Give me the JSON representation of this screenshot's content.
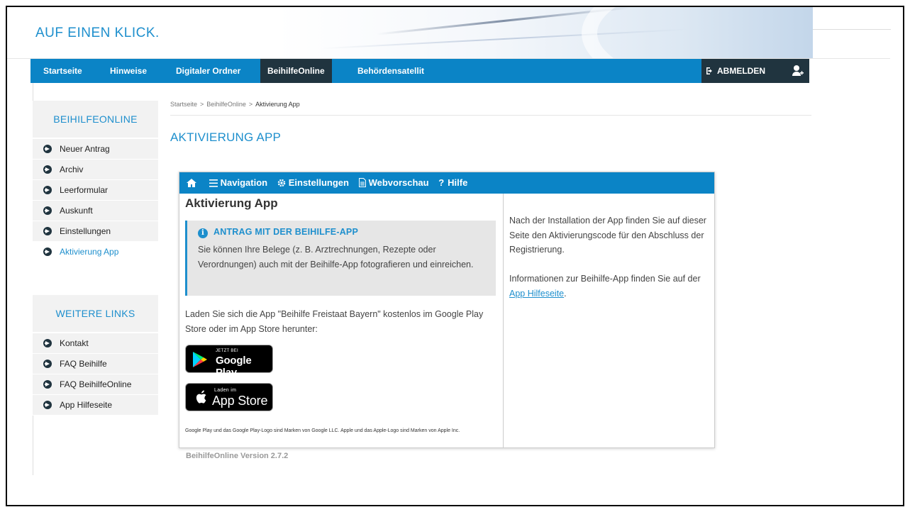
{
  "banner": {
    "tagline": "AUF EINEN KLICK."
  },
  "nav": {
    "items": [
      "Startseite",
      "Hinweise",
      "Digitaler Ordner",
      "BeihilfeOnline",
      "Behördensatellit"
    ],
    "logout": "ABMELDEN"
  },
  "sidebar": {
    "section1_title": "BEIHILFEONLINE",
    "section1_items": [
      "Neuer Antrag",
      "Archiv",
      "Leerformular",
      "Auskunft",
      "Einstellungen",
      "Aktivierung App"
    ],
    "section2_title": "WEITERE LINKS",
    "section2_items": [
      "Kontakt",
      "FAQ Beihilfe",
      "FAQ BeihilfeOnline",
      "App Hilfeseite"
    ]
  },
  "breadcrumb": {
    "items": [
      "Startseite",
      "BeihilfeOnline",
      "Aktivierung App"
    ],
    "separator": ">"
  },
  "page": {
    "title": "AKTIVIERUNG APP"
  },
  "app": {
    "toolbar": {
      "navigation": "Navigation",
      "settings": "Einstellungen",
      "preview": "Webvorschau",
      "help": "Hilfe"
    },
    "heading": "Aktivierung App",
    "info": {
      "title": "ANTRAG MIT DER BEIHILFE-APP",
      "text": "Sie können Ihre Belege (z. B. Arztrechnungen, Rezepte oder Verordnungen) auch mit der Beihilfe-App fotografieren und einreichen."
    },
    "download_text": "Laden Sie sich die App \"Beihilfe Freistaat Bayern\" kostenlos im Google Play Store oder im App Store herunter:",
    "google_play": {
      "small": "JETZT BEI",
      "big": "Google Play"
    },
    "app_store": {
      "small": "Laden im",
      "big": "App Store"
    },
    "legal": "Google Play und das Google Play-Logo sind Marken von Google LLC. Apple und das Apple-Logo sind Marken von Apple Inc.",
    "right": {
      "para1": "Nach der Installation der App finden Sie auf dieser Seite den Aktivierungscode für den Abschluss der Registrierung.",
      "para2_prefix": "Informationen zur Beihilfe-App finden Sie auf der ",
      "para2_link": "App Hilfeseite",
      "para2_suffix": "."
    }
  },
  "footer": {
    "version": "BeihilfeOnline Version 2.7.2"
  },
  "colors": {
    "primary": "#0b84c6",
    "dark": "#20343f",
    "link": "#1e8fcd"
  }
}
